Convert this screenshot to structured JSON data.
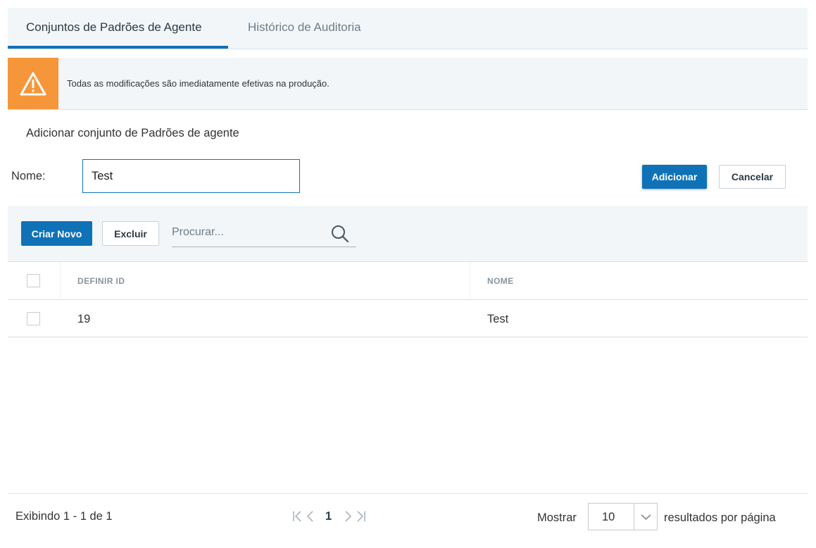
{
  "tabs": [
    {
      "label": "Conjuntos de Padrões de Agente",
      "active": true
    },
    {
      "label": "Histórico de Auditoria",
      "active": false
    }
  ],
  "warning": {
    "icon": "warning-triangle-icon",
    "color": "#f5963a",
    "text": "Todas as modificações são imediatamente efetivas na produção."
  },
  "add_form": {
    "title": "Adicionar conjunto de Padrões de agente",
    "name_label": "Nome:",
    "name_value": "Test",
    "add_label": "Adicionar",
    "cancel_label": "Cancelar"
  },
  "toolbar": {
    "create_label": "Criar Novo",
    "delete_label": "Excluir",
    "search_placeholder": "Procurar..."
  },
  "table": {
    "columns": [
      "DEFINIR ID",
      "NOME"
    ],
    "rows": [
      {
        "id": "19",
        "name": "Test",
        "checked": false
      }
    ]
  },
  "footer": {
    "showing": "Exibindo 1 - 1 de 1",
    "current_page": "1",
    "show_label": "Mostrar",
    "page_size": "10",
    "per_page_label": "resultados por página"
  },
  "colors": {
    "accent": "#0f72b7",
    "warning": "#f5963a",
    "panel": "#f2f6f9"
  }
}
